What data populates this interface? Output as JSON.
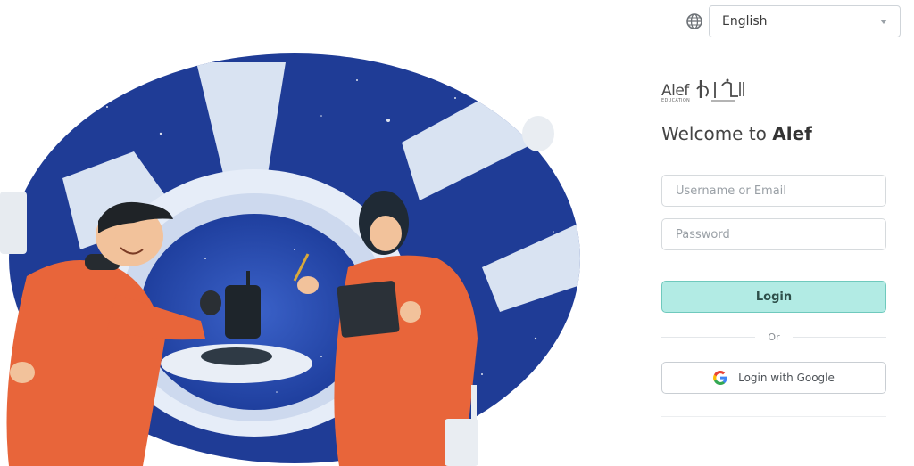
{
  "language": {
    "selected": "English",
    "globe_icon": "globe-icon",
    "caret_icon": "chevron-down-icon"
  },
  "logo": {
    "text_en": "Alef",
    "subtitle": "EDUCATION"
  },
  "welcome": {
    "prefix": "Welcome to ",
    "brand": "Alef"
  },
  "form": {
    "username_placeholder": "Username or Email",
    "password_placeholder": "Password",
    "login_label": "Login",
    "or_label": "Or",
    "google_label": "Login with Google"
  },
  "colors": {
    "login_bg": "#b2ebe4",
    "login_border": "#6fc9bd",
    "space_blue": "#2345a8",
    "suit_orange": "#e8653a"
  }
}
